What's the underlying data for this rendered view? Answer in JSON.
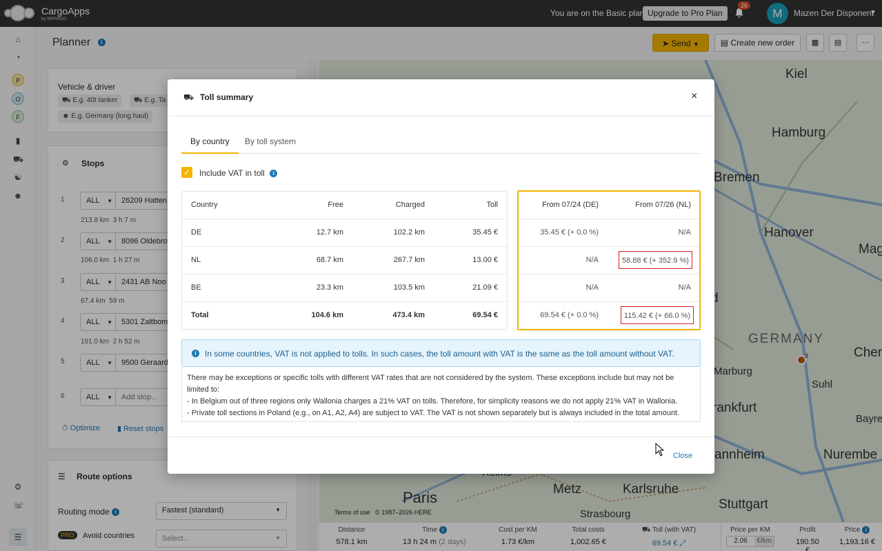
{
  "topbar": {
    "app_name": "CargoApps",
    "app_sub": "by IMPARGO",
    "plan_text": "You are on the Basic plan",
    "upgrade_label": "Upgrade to Pro Plan",
    "notification_count": "26",
    "avatar_letter": "M",
    "user_name": "Mazen Der Disponent"
  },
  "nav": {
    "letters": [
      "P",
      "O",
      "F"
    ]
  },
  "page": {
    "title": "Planner",
    "send_label": "Send",
    "new_order_label": "Create new order"
  },
  "planner": {
    "vehicle_title": "Vehicle & driver",
    "chips": [
      "E.g. 40t tanker",
      "E.g. Ta",
      "E.g. Germany (long haul)"
    ],
    "stops_title": "Stops",
    "stops": [
      {
        "num": "1",
        "type": "ALL",
        "address": "26209 Hatten"
      },
      {
        "num": "2",
        "type": "ALL",
        "address": "8096 Oldebro"
      },
      {
        "num": "3",
        "type": "ALL",
        "address": "2431 AB Noo"
      },
      {
        "num": "4",
        "type": "ALL",
        "address": "5301 Zaltbom"
      },
      {
        "num": "5",
        "type": "ALL",
        "address": "9500 Geraard"
      },
      {
        "num": "6",
        "type": "ALL",
        "address": "Add stop..."
      }
    ],
    "legs": [
      {
        "km": "213.8 km",
        "time": "3 h 7 m"
      },
      {
        "km": "106.0 km",
        "time": "1 h 27 m"
      },
      {
        "km": "67.4 km",
        "time": "59 m"
      },
      {
        "km": "191.0 km",
        "time": "2 h 52 m"
      }
    ],
    "optimize_label": "Optimize",
    "reset_label": "Reset stops",
    "route_options_title": "Route options",
    "routing_mode_label": "Routing mode",
    "routing_mode_value": "Fastest (standard)",
    "pro_badge": "PRO",
    "avoid_label": "Avoid countries",
    "avoid_placeholder": "Select..."
  },
  "map": {
    "cities": [
      {
        "name": "Kiel"
      },
      {
        "name": "Hamburg"
      },
      {
        "name": "Bremen"
      },
      {
        "name": "Hanover"
      },
      {
        "name": "Mage"
      },
      {
        "name": "GERMANY"
      },
      {
        "name": "Marburg"
      },
      {
        "name": "Suhl"
      },
      {
        "name": "Chem"
      },
      {
        "name": "rankfurt"
      },
      {
        "name": "Bayre"
      },
      {
        "name": "annheim"
      },
      {
        "name": "Nurembe"
      },
      {
        "name": "Karlsruhe"
      },
      {
        "name": "Stuttgart"
      },
      {
        "name": "Metz"
      },
      {
        "name": "Paris"
      },
      {
        "name": "Reims"
      },
      {
        "name": "Strasbourg"
      },
      {
        "name": "d"
      }
    ],
    "marker_label": "3",
    "terms": "Terms of use",
    "copyright": "© 1987–2026 HERE"
  },
  "stats": {
    "distance_label": "Distance",
    "distance_value": "578.1 km",
    "time_label": "Time",
    "time_value": "13 h 24 m",
    "time_days": "(2 days)",
    "cost_km_label": "Cost per KM",
    "cost_km_value": "1.73 €/km",
    "total_costs_label": "Total costs",
    "total_costs_value": "1,002.65 €",
    "toll_label": "Toll (with VAT)",
    "toll_value": "69.54 €",
    "price_km_label": "Price per KM",
    "price_km_value": "2.06",
    "price_km_unit": "€/km",
    "profit_label": "Profit",
    "profit_value": "190.50 €",
    "price_label": "Price",
    "price_value": "1,193.16 €"
  },
  "modal": {
    "title": "Toll summary",
    "tabs": [
      {
        "label": "By country"
      },
      {
        "label": "By toll system"
      }
    ],
    "vat_label": "Include VAT in toll",
    "table": {
      "headers": [
        "Country",
        "Free",
        "Charged",
        "Toll"
      ],
      "rows": [
        [
          "DE",
          "12.7 km",
          "102.2 km",
          "35.45 €"
        ],
        [
          "NL",
          "68.7 km",
          "267.7 km",
          "13.00 €"
        ],
        [
          "BE",
          "23.3 km",
          "103.5 km",
          "21.09 €"
        ],
        [
          "Total",
          "104.6 km",
          "473.4 km",
          "69.54 €"
        ]
      ]
    },
    "forecast": {
      "headers": [
        "From 07/24 (DE)",
        "From 07/26 (NL)"
      ],
      "rows": [
        [
          "35.45 € (+ 0.0 %)",
          "N/A"
        ],
        [
          "N/A",
          "58.88 € (+ 352.9 %)"
        ],
        [
          "N/A",
          "N/A"
        ],
        [
          "69.54 € (+ 0.0 %)",
          "115.42 € (+ 66.0 %)"
        ]
      ]
    },
    "info_text": "In some countries, VAT is not applied to tolls. In such cases, the toll amount with VAT is the same as the toll amount without VAT.",
    "note_lines": [
      "There may be exceptions or specific tolls with different VAT rates that are not considered by the system. These exceptions include but may not be limited to:",
      "- In Belgium out of three regions only Wallonia charges a 21% VAT on tolls. Therefore, for simplicity reasons we do not apply 21% VAT in Wallonia.",
      "- Private toll sections in Poland (e.g., on A1, A2, A4) are subject to VAT. The VAT is not shown separately but is always included in the total amount."
    ],
    "close_label": "Close"
  },
  "colors": {
    "accent": "#f4b400",
    "highlight_red": "#d62020",
    "info_blue": "#1f78b4",
    "topbar": "#333333"
  }
}
